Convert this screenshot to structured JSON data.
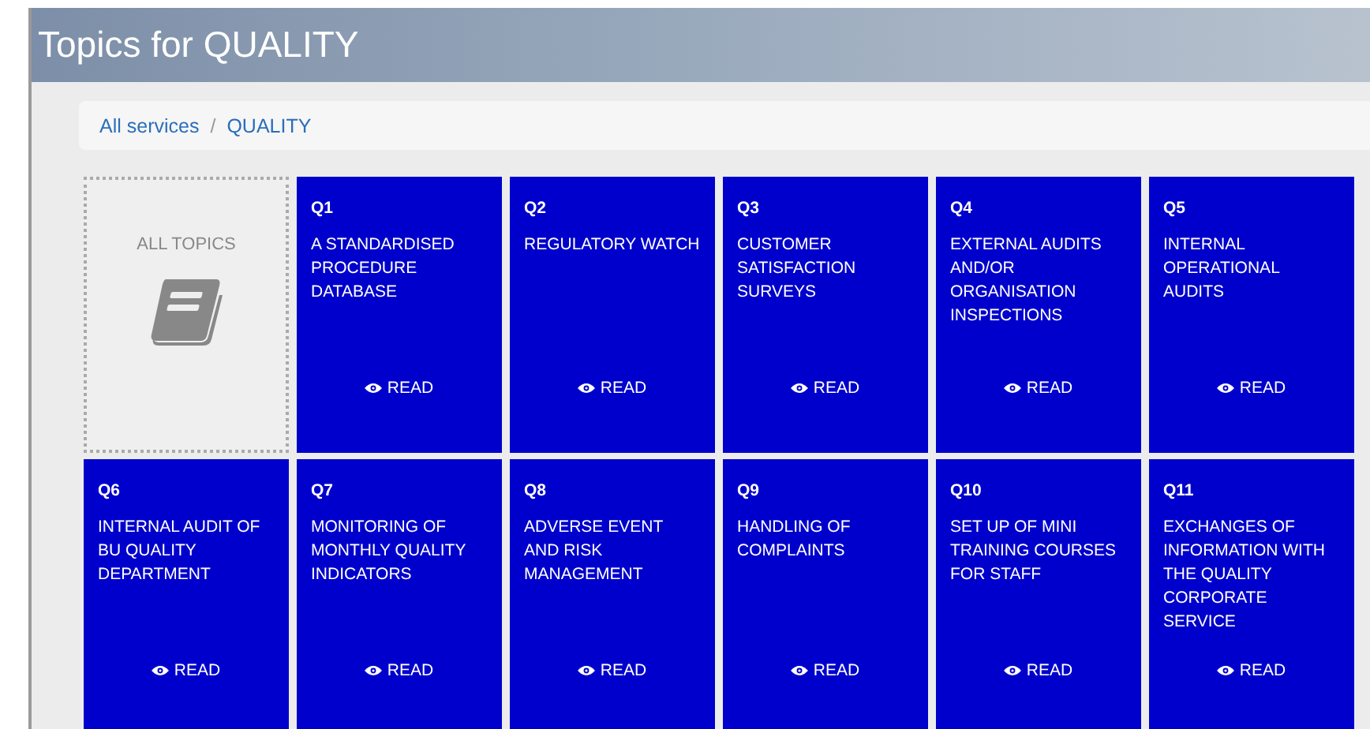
{
  "header": {
    "title": "Topics for QUALITY"
  },
  "breadcrumb": [
    {
      "label": "All services"
    },
    {
      "label": "QUALITY"
    }
  ],
  "breadcrumb_separator": "/",
  "all_topics": {
    "label": "ALL TOPICS"
  },
  "topics": [
    {
      "code": "Q1",
      "title": "A STANDARDISED PROCEDURE DATABASE",
      "action": "READ"
    },
    {
      "code": "Q2",
      "title": "REGULATORY WATCH",
      "action": "READ"
    },
    {
      "code": "Q3",
      "title": "CUSTOMER SATISFACTION SURVEYS",
      "action": "READ"
    },
    {
      "code": "Q4",
      "title": "EXTERNAL AUDITS AND/OR ORGANISATION INSPECTIONS",
      "action": "READ"
    },
    {
      "code": "Q5",
      "title": "INTERNAL OPERATIONAL AUDITS",
      "action": "READ"
    },
    {
      "code": "Q6",
      "title": "INTERNAL AUDIT OF BU QUALITY DEPARTMENT",
      "action": "READ"
    },
    {
      "code": "Q7",
      "title": "MONITORING OF MONTHLY QUALITY INDICATORS",
      "action": "READ"
    },
    {
      "code": "Q8",
      "title": "ADVERSE EVENT AND RISK MANAGEMENT",
      "action": "READ"
    },
    {
      "code": "Q9",
      "title": "HANDLING OF COMPLAINTS",
      "action": "READ"
    },
    {
      "code": "Q10",
      "title": "SET UP OF MINI TRAINING COURSES FOR STAFF",
      "action": "READ"
    },
    {
      "code": "Q11",
      "title": "EXCHANGES OF INFORMATION WITH THE QUALITY CORPORATE SERVICE",
      "action": "READ"
    }
  ]
}
